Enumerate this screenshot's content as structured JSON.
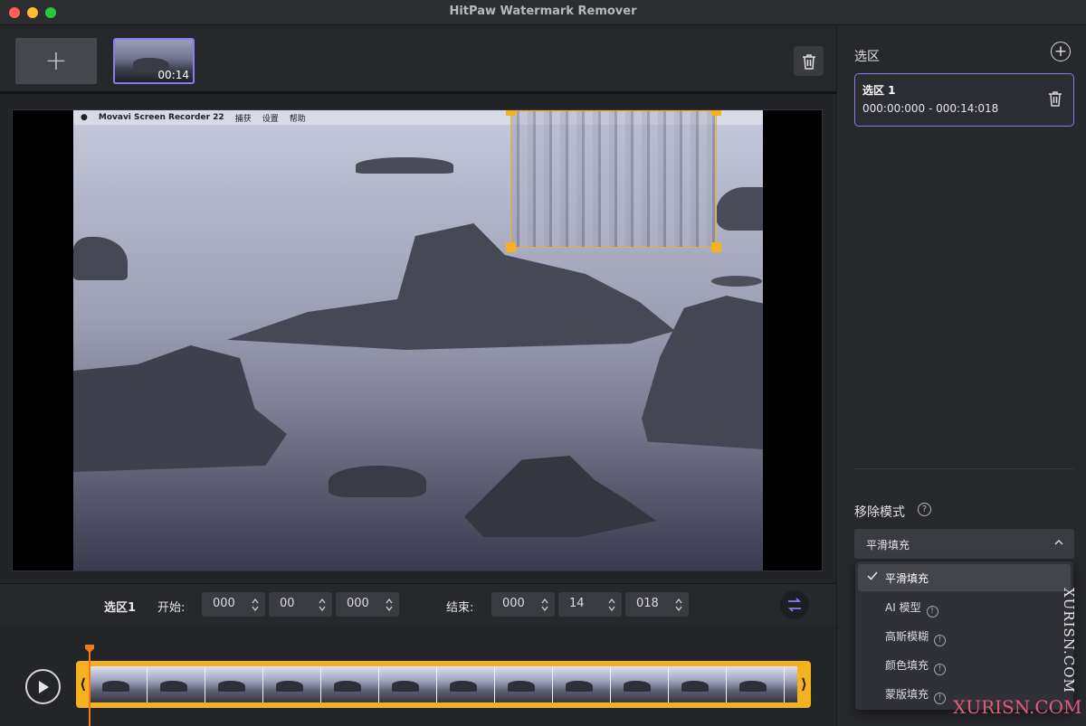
{
  "window": {
    "title": "HitPaw Watermark Remover"
  },
  "files": {
    "add_label": "+",
    "thumbnail_duration": "00:14"
  },
  "preview": {
    "menubar": {
      "app_name": "Movavi Screen Recorder 22",
      "items": [
        "捕获",
        "设置",
        "帮助"
      ]
    }
  },
  "selection_bar": {
    "name": "选区1",
    "start_label": "开始:",
    "start": [
      "000",
      "00",
      "000"
    ],
    "end_label": "结束:",
    "end": [
      "000",
      "14",
      "018"
    ]
  },
  "right_panel": {
    "section_title": "选区",
    "selection": {
      "name": "选区 1",
      "range": "000:00:000 - 000:14:018"
    },
    "mode_label": "移除模式",
    "mode_selected": "平滑填充",
    "mode_options": [
      {
        "label": "平滑填充",
        "checked": true,
        "info": false
      },
      {
        "label": "AI 模型",
        "checked": false,
        "info": true
      },
      {
        "label": "高斯模糊",
        "checked": false,
        "info": true
      },
      {
        "label": "颜色填充",
        "checked": false,
        "info": true
      },
      {
        "label": "蒙版填充",
        "checked": false,
        "info": true
      }
    ]
  },
  "watermarks": {
    "vertical": "XURISN.COM",
    "bottom": "XURISN.COM"
  },
  "colors": {
    "accent": "#8c7bf0",
    "selection": "#f5b021",
    "playhead": "#f07a1e"
  }
}
